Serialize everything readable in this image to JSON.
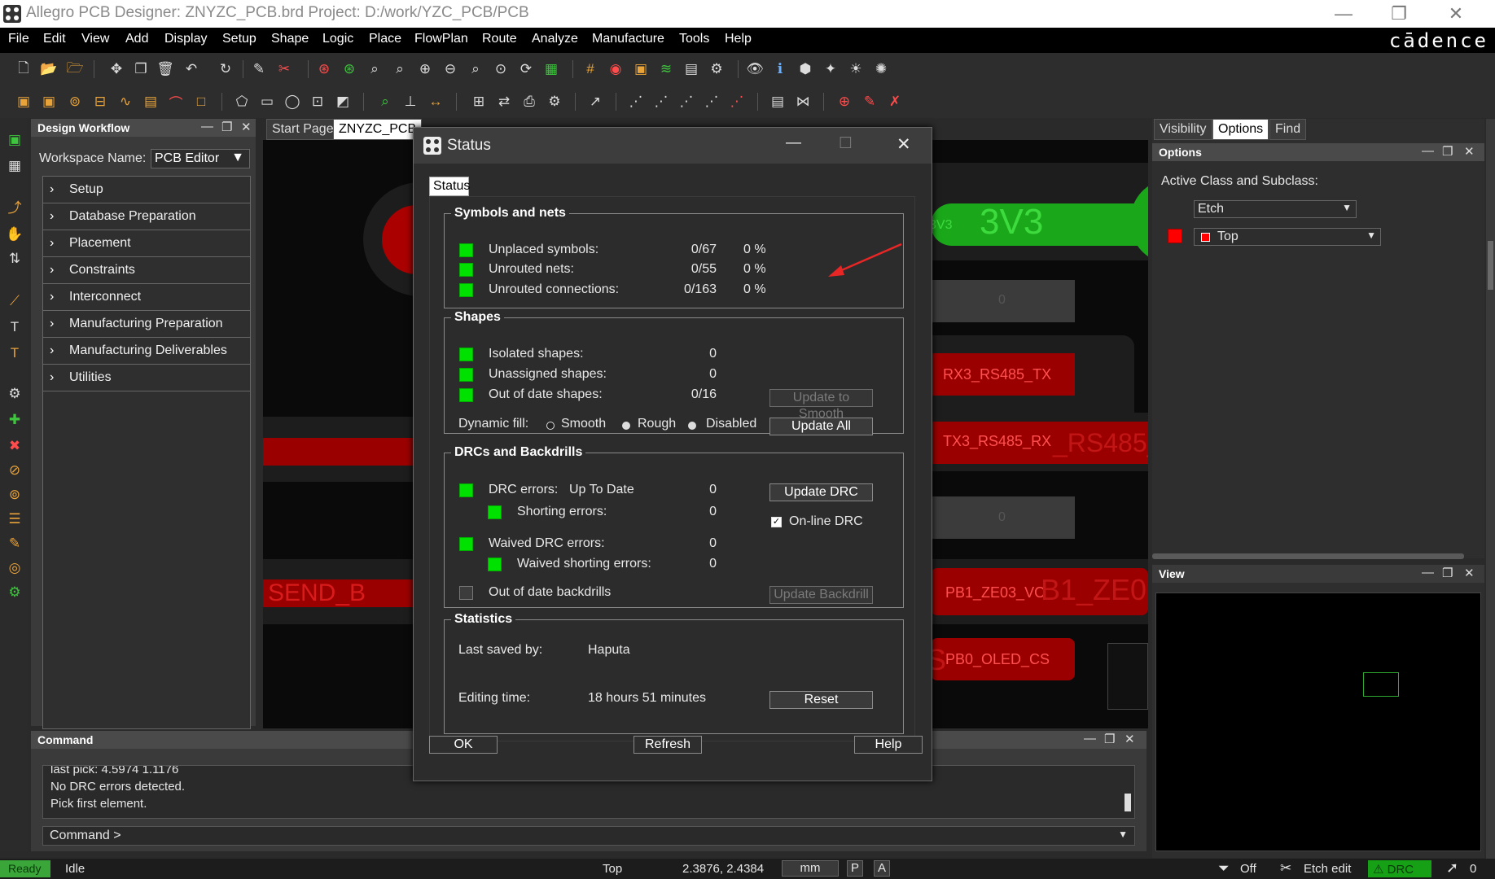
{
  "window": {
    "title": "Allegro PCB Designer: ZNYZC_PCB.brd  Project: D:/work/YZC_PCB/PCB",
    "minimize": "—",
    "restore": "❐",
    "close": "✕"
  },
  "menu": {
    "items": [
      "File",
      "Edit",
      "View",
      "Add",
      "Display",
      "Setup",
      "Shape",
      "Logic",
      "Place",
      "FlowPlan",
      "Route",
      "Analyze",
      "Manufacture",
      "Tools",
      "Help"
    ],
    "brand": "cādence"
  },
  "workflow": {
    "title": "Design Workflow",
    "workspace_label": "Workspace Name:",
    "workspace_value": "PCB Editor",
    "items": [
      "Setup",
      "Database Preparation",
      "Placement",
      "Constraints",
      "Interconnect",
      "Manufacturing Preparation",
      "Manufacturing Deliverables",
      "Utilities"
    ]
  },
  "doc_tabs": [
    "Start Page",
    "ZNYZC_PCB"
  ],
  "canvas": {
    "net_labels": [
      "3V3",
      "3V3",
      "0",
      "RX3_RS485_TX",
      "TX3_RS485_RX",
      "_RS485_",
      "0",
      "SEND_B",
      "PB1_ZE03_VO",
      "B1_ZE0",
      "PB0_OLED_CS",
      "S"
    ]
  },
  "right_panel": {
    "tabs": [
      "Visibility",
      "Options",
      "Find"
    ],
    "header": "Options",
    "active_label": "Active Class and Subclass:",
    "class_value": "Etch",
    "subclass_value": "Top",
    "subclass_color": "#ff0000"
  },
  "view_panel": {
    "title": "View"
  },
  "command": {
    "title": "Command",
    "lines": [
      "last pick:  4.5974 1.1176",
      "No DRC errors detected.",
      "Pick first element."
    ],
    "prompt": "Command >"
  },
  "statusbar": {
    "ready": "Ready",
    "state": "Idle",
    "layer": "Top",
    "coords": "2.3876, 2.4384",
    "units": "mm",
    "p": "P",
    "a": "A",
    "filter": "Off",
    "mode": "Etch edit",
    "drc": "DRC",
    "count": "0"
  },
  "dialog": {
    "title": "Status",
    "tab": "Status",
    "symbols": {
      "legend": "Symbols and nets",
      "rows": [
        {
          "label": "Unplaced symbols:",
          "count": "0/67",
          "pct": "0 %"
        },
        {
          "label": "Unrouted nets:",
          "count": "0/55",
          "pct": "0 %"
        },
        {
          "label": "Unrouted connections:",
          "count": "0/163",
          "pct": "0 %"
        }
      ]
    },
    "shapes": {
      "legend": "Shapes",
      "isolated": {
        "label": "Isolated shapes:",
        "value": "0"
      },
      "unassigned": {
        "label": "Unassigned shapes:",
        "value": "0"
      },
      "outofdate": {
        "label": "Out of date shapes:",
        "value": "0/16"
      },
      "update_smooth": "Update to Smooth",
      "fill_label": "Dynamic fill:",
      "fill_options": [
        "Smooth",
        "Rough",
        "Disabled"
      ],
      "update_all": "Update All"
    },
    "drc": {
      "legend": "DRCs and Backdrills",
      "errors_label": "DRC errors:",
      "errors_state": "Up To Date",
      "errors_value": "0",
      "update_drc": "Update DRC",
      "shorting_label": "Shorting errors:",
      "shorting_value": "0",
      "online_drc": "On-line DRC",
      "waived_label": "Waived DRC errors:",
      "waived_value": "0",
      "waived_short_label": "Waived shorting errors:",
      "waived_short_value": "0",
      "backdrill_label": "Out of date backdrills",
      "update_backdrill": "Update Backdrill"
    },
    "stats": {
      "legend": "Statistics",
      "saved_label": "Last saved by:",
      "saved_value": "Haputa",
      "editing_label": "Editing time:",
      "editing_value": "18 hours 51 minutes",
      "reset": "Reset"
    },
    "ok": "OK",
    "refresh": "Refresh",
    "help": "Help"
  }
}
